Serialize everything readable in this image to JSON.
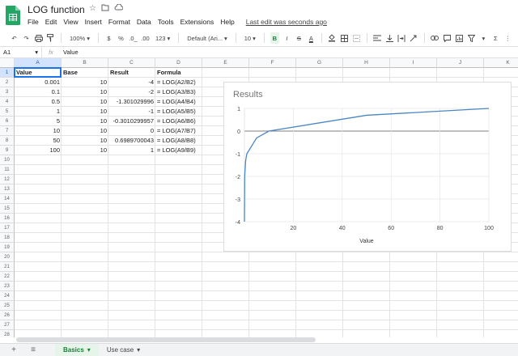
{
  "app": {
    "title": "LOG function",
    "last_edit": "Last edit was seconds ago",
    "menu": [
      "File",
      "Edit",
      "View",
      "Insert",
      "Format",
      "Data",
      "Tools",
      "Extensions",
      "Help"
    ],
    "title_icons": [
      "star-icon",
      "move-folder-icon",
      "cloud-status-icon"
    ]
  },
  "toolbar": {
    "zoom": "100%",
    "currency": "$",
    "percent": "%",
    "dec_decrease": ".0_",
    "dec_increase": ".00",
    "number_format": "123",
    "font": "Default (Ari...",
    "font_size": "10",
    "bold": "B",
    "italic": "I",
    "strike": "S",
    "text_color": "A",
    "more": "⋮"
  },
  "formula_bar": {
    "name_box": "A1",
    "fx": "fx",
    "value": "Value"
  },
  "grid": {
    "columns": [
      "A",
      "B",
      "C",
      "D",
      "E",
      "F",
      "G",
      "H",
      "I",
      "J",
      "K"
    ],
    "rows": [
      "1",
      "2",
      "3",
      "4",
      "5",
      "6",
      "7",
      "8",
      "9",
      "10",
      "11",
      "12",
      "13",
      "14",
      "15",
      "16",
      "17",
      "18",
      "19",
      "20",
      "21",
      "22",
      "23",
      "24",
      "25",
      "26",
      "27",
      "28"
    ],
    "headers": [
      "Value",
      "Base",
      "Result",
      "Formula"
    ],
    "data": [
      [
        "0.001",
        "10",
        "-4",
        "= LOG(A2/B2)"
      ],
      [
        "0.1",
        "10",
        "-2",
        "= LOG(A3/B3)"
      ],
      [
        "0.5",
        "10",
        "-1.301029996",
        "= LOG(A4/B4)"
      ],
      [
        "1",
        "10",
        "-1",
        "= LOG(A5/B5)"
      ],
      [
        "5",
        "10",
        "-0.3010299957",
        "= LOG(A6/B6)"
      ],
      [
        "10",
        "10",
        "0",
        "= LOG(A7/B7)"
      ],
      [
        "50",
        "10",
        "0.6989700043",
        "= LOG(A8/B8)"
      ],
      [
        "100",
        "10",
        "1",
        "= LOG(A9/B9)"
      ]
    ]
  },
  "chart_data": {
    "type": "line",
    "title": "Results",
    "xlabel": "Value",
    "ylabel": "",
    "x": [
      0.001,
      0.1,
      0.5,
      1,
      5,
      10,
      50,
      100
    ],
    "series": [
      {
        "values": [
          -4,
          -2,
          -1.301029996,
          -1,
          -0.3010299957,
          0,
          0.6989700043,
          1
        ]
      }
    ],
    "xlim": [
      0,
      100
    ],
    "ylim": [
      -4,
      1
    ],
    "xticks": [
      20,
      40,
      60,
      80,
      100
    ],
    "yticks": [
      1,
      0,
      -1,
      -2,
      -3,
      -4
    ],
    "grid": true,
    "line_color": "#4a86c5"
  },
  "sheets": {
    "tabs": [
      "Basics",
      "Use case"
    ],
    "active": "Basics"
  }
}
